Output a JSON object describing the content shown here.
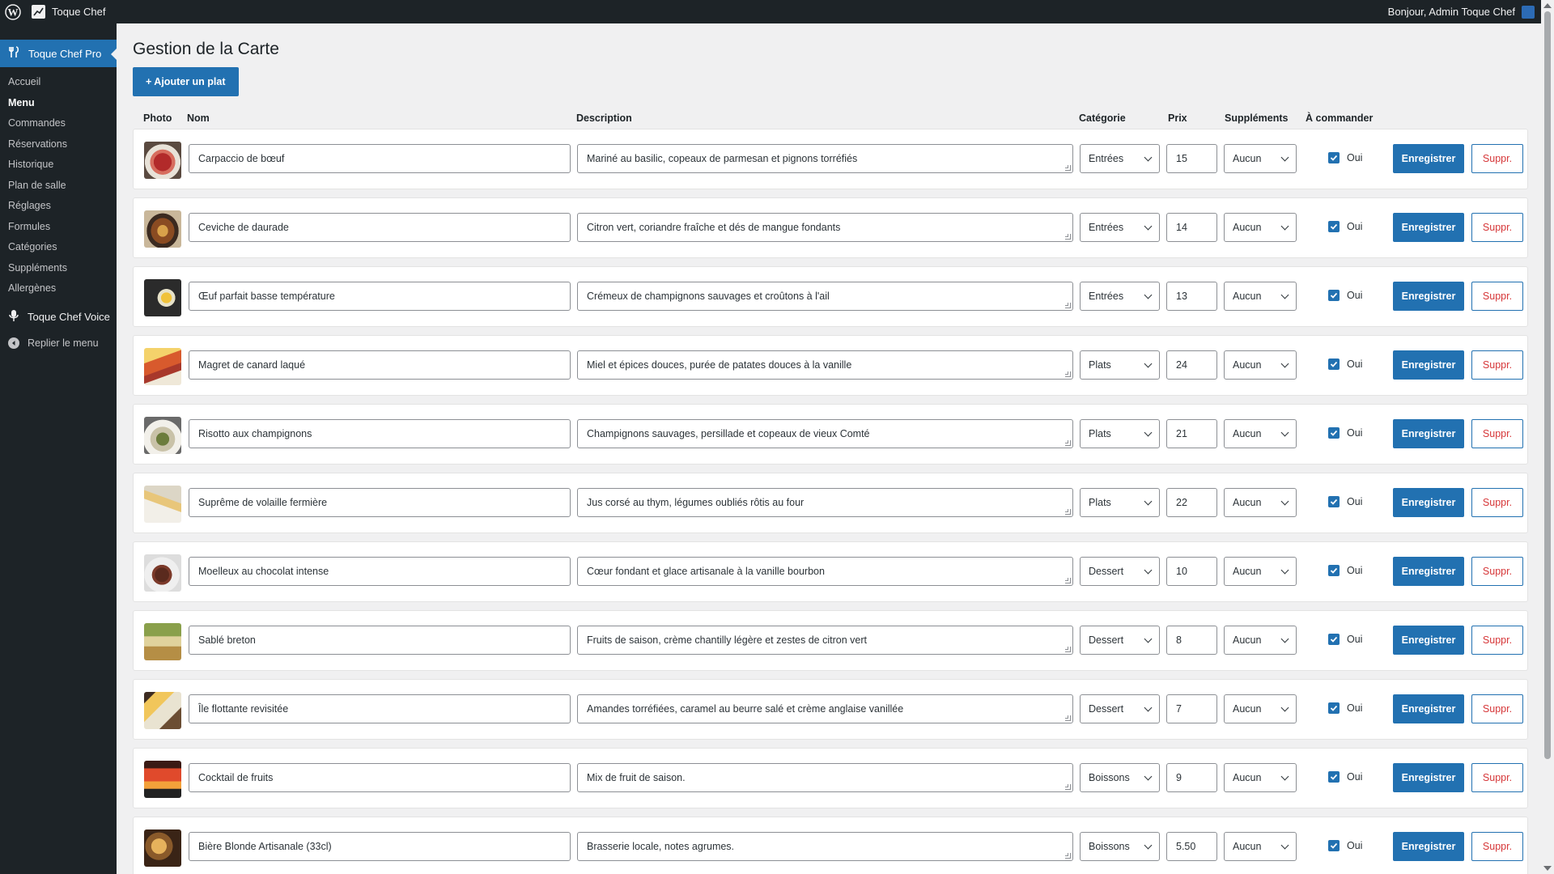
{
  "adminbar": {
    "site_name": "Toque Chef",
    "greeting": "Bonjour, Admin Toque Chef"
  },
  "sidebar": {
    "plugin_name": "Toque Chef Pro",
    "items": [
      {
        "label": "Accueil"
      },
      {
        "label": "Menu"
      },
      {
        "label": "Commandes"
      },
      {
        "label": "Réservations"
      },
      {
        "label": "Historique"
      },
      {
        "label": "Plan de salle"
      },
      {
        "label": "Réglages"
      },
      {
        "label": "Formules"
      },
      {
        "label": "Catégories"
      },
      {
        "label": "Suppléments"
      },
      {
        "label": "Allergènes"
      }
    ],
    "voice_label": "Toque Chef Voice",
    "collapse_label": "Replier le menu"
  },
  "page": {
    "title": "Gestion de la Carte",
    "add_button": "+ Ajouter un plat"
  },
  "columns": {
    "photo": "Photo",
    "name": "Nom",
    "description": "Description",
    "category": "Catégorie",
    "price": "Prix",
    "supplements": "Suppléments",
    "orderable": "À commander"
  },
  "row_labels": {
    "checkbox_label": "Oui",
    "save": "Enregistrer",
    "delete": "Suppr."
  },
  "dishes": [
    {
      "name": "Carpaccio de bœuf",
      "description": "Mariné au basilic, copeaux de parmesan et pignons torréfiés",
      "category": "Entrées",
      "price": "15",
      "supplement": "Aucun"
    },
    {
      "name": "Ceviche de daurade",
      "description": "Citron vert, coriandre fraîche et dés de mangue fondants",
      "category": "Entrées",
      "price": "14",
      "supplement": "Aucun"
    },
    {
      "name": "Œuf parfait basse température",
      "description": "Crémeux de champignons sauvages et croûtons à l'ail",
      "category": "Entrées",
      "price": "13",
      "supplement": "Aucun"
    },
    {
      "name": "Magret de canard laqué",
      "description": "Miel et épices douces, purée de patates douces à la vanille",
      "category": "Plats",
      "price": "24",
      "supplement": "Aucun"
    },
    {
      "name": "Risotto aux champignons",
      "description": "Champignons sauvages, persillade et copeaux de vieux Comté",
      "category": "Plats",
      "price": "21",
      "supplement": "Aucun"
    },
    {
      "name": "Suprême de volaille fermière",
      "description": "Jus corsé au thym, légumes oubliés rôtis au four",
      "category": "Plats",
      "price": "22",
      "supplement": "Aucun"
    },
    {
      "name": "Moelleux au chocolat intense",
      "description": "Cœur fondant et glace artisanale à la vanille bourbon",
      "category": "Dessert",
      "price": "10",
      "supplement": "Aucun"
    },
    {
      "name": "Sablé breton",
      "description": "Fruits de saison, crème chantilly légère et zestes de citron vert",
      "category": "Dessert",
      "price": "8",
      "supplement": "Aucun"
    },
    {
      "name": "Île flottante revisitée",
      "description": "Amandes torréfiées, caramel au beurre salé et crème anglaise vanillée",
      "category": "Dessert",
      "price": "7",
      "supplement": "Aucun"
    },
    {
      "name": "Cocktail de fruits",
      "description": "Mix de fruit de saison.",
      "category": "Boissons",
      "price": "9",
      "supplement": "Aucun"
    },
    {
      "name": "Bière Blonde Artisanale (33cl)",
      "description": "Brasserie locale, notes agrumes.",
      "category": "Boissons",
      "price": "5.50",
      "supplement": "Aucun"
    }
  ],
  "colors": {
    "primary": "#2271b1",
    "sidebar_bg": "#1d2327",
    "danger": "#d63638"
  }
}
